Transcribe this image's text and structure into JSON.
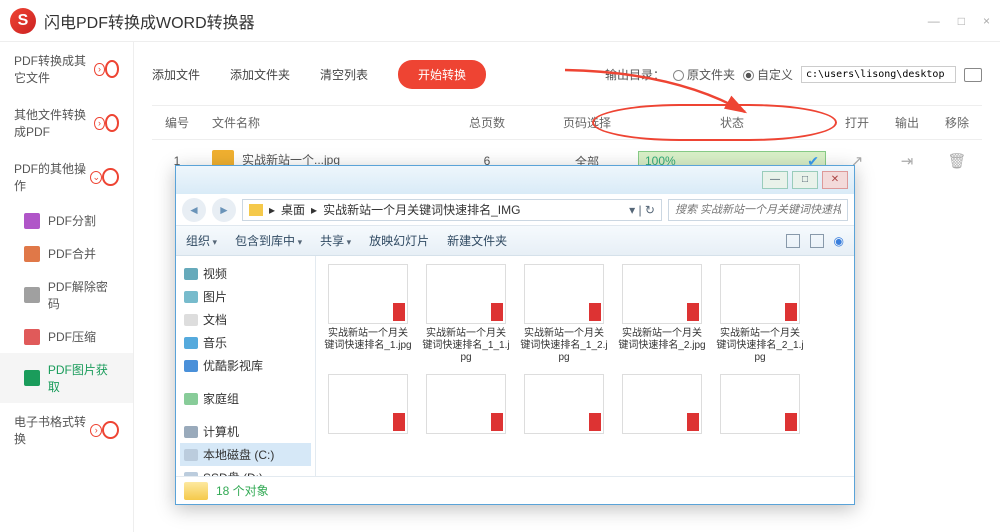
{
  "app": {
    "title": "闪电PDF转换成WORD转换器"
  },
  "winctrls": {
    "min": "—",
    "max": "□",
    "close": "×"
  },
  "sidebar": {
    "groups": [
      {
        "label": "PDF转换成其它文件"
      },
      {
        "label": "其他文件转换成PDF"
      },
      {
        "label": "PDF的其他操作"
      },
      {
        "label": "电子书格式转换"
      }
    ],
    "items": [
      {
        "label": "PDF分割",
        "color": "#b055c8"
      },
      {
        "label": "PDF合并",
        "color": "#e07848"
      },
      {
        "label": "PDF解除密码",
        "color": "#a0a0a0"
      },
      {
        "label": "PDF压缩",
        "color": "#e05a5a"
      },
      {
        "label": "PDF图片获取",
        "color": "#1a9c5b"
      }
    ]
  },
  "toolbar": {
    "add_file": "添加文件",
    "add_folder": "添加文件夹",
    "clear": "清空列表",
    "start": "开始转换",
    "output_label": "输出目录：",
    "opt_source": "原文件夹",
    "opt_custom": "自定义",
    "path": "c:\\users\\lisong\\desktop"
  },
  "table": {
    "headers": {
      "num": "编号",
      "name": "文件名称",
      "pages": "总页数",
      "sel": "页码选择",
      "status": "状态",
      "open": "打开",
      "out": "输出",
      "del": "移除"
    },
    "row": {
      "num": "1",
      "name": "实战新站一个...jpg",
      "pages": "6",
      "sel": "全部",
      "progress": "100%"
    }
  },
  "explorer": {
    "crumb_desktop": "桌面",
    "crumb_folder": "实战新站一个月关键词快速排名_IMG",
    "search_placeholder": "搜索 实战新站一个月关键词快速排名...",
    "organize": "组织",
    "include": "包含到库中",
    "share": "共享",
    "slideshow": "放映幻灯片",
    "newfolder": "新建文件夹",
    "tree": {
      "video": "视频",
      "pictures": "图片",
      "docs": "文档",
      "music": "音乐",
      "youku": "优酷影视库",
      "homegroup": "家庭组",
      "computer": "计算机",
      "cdrive": "本地磁盘 (C:)",
      "ddrive": "SSD盘 (D:)"
    },
    "files": [
      "实战新站一个月关键词快速排名_1.jpg",
      "实战新站一个月关键词快速排名_1_1.jpg",
      "实战新站一个月关键词快速排名_1_2.jpg",
      "实战新站一个月关键词快速排名_2.jpg",
      "实战新站一个月关键词快速排名_2_1.jpg"
    ],
    "status_count": "18 个对象"
  }
}
